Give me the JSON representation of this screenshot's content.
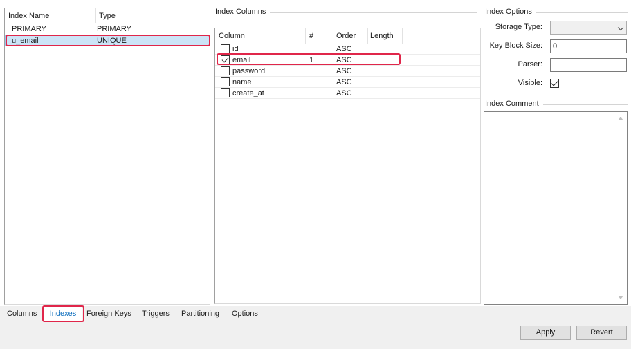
{
  "index_list": {
    "headers": {
      "name": "Index Name",
      "type": "Type"
    },
    "rows": [
      {
        "name": "PRIMARY",
        "type": "PRIMARY"
      },
      {
        "name": "u_email",
        "type": "UNIQUE"
      }
    ],
    "selected_row": 1
  },
  "index_columns": {
    "group_label": "Index Columns",
    "headers": {
      "column": "Column",
      "num": "#",
      "order": "Order",
      "length": "Length"
    },
    "rows": [
      {
        "checked": false,
        "column": "id",
        "num": "",
        "order": "ASC",
        "length": ""
      },
      {
        "checked": true,
        "column": "email",
        "num": "1",
        "order": "ASC",
        "length": ""
      },
      {
        "checked": false,
        "column": "password",
        "num": "",
        "order": "ASC",
        "length": ""
      },
      {
        "checked": false,
        "column": "name",
        "num": "",
        "order": "ASC",
        "length": ""
      },
      {
        "checked": false,
        "column": "create_at",
        "num": "",
        "order": "ASC",
        "length": ""
      }
    ]
  },
  "index_options": {
    "group_label": "Index Options",
    "storage_type_label": "Storage Type:",
    "storage_type_value": "",
    "key_block_size_label": "Key Block Size:",
    "key_block_size_value": "0",
    "parser_label": "Parser:",
    "parser_value": "",
    "visible_label": "Visible:",
    "visible_checked": true
  },
  "index_comment": {
    "group_label": "Index Comment",
    "value": ""
  },
  "tabs": [
    {
      "label": "Columns",
      "active": false
    },
    {
      "label": "Indexes",
      "active": true
    },
    {
      "label": "Foreign Keys",
      "active": false
    },
    {
      "label": "Triggers",
      "active": false
    },
    {
      "label": "Partitioning",
      "active": false
    },
    {
      "label": "Options",
      "active": false
    }
  ],
  "buttons": {
    "apply": "Apply",
    "revert": "Revert"
  },
  "colors": {
    "highlight": "#e0264a",
    "selection": "#cce4f7",
    "active_tab_text": "#0a6cbc"
  }
}
